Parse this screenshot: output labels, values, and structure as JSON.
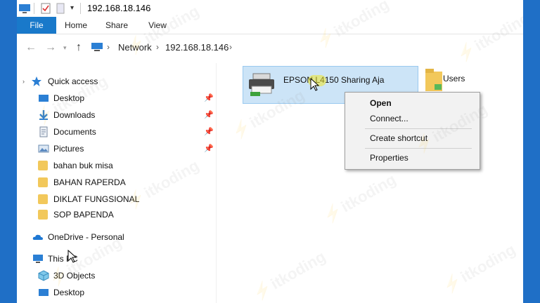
{
  "window": {
    "title": "192.168.18.146"
  },
  "ribbon": {
    "tabs": [
      "File",
      "Home",
      "Share",
      "View"
    ]
  },
  "address": {
    "crumbs": [
      "Network",
      "192.168.18.146"
    ]
  },
  "sidebar": {
    "quick_access": "Quick access",
    "items": [
      "Desktop",
      "Downloads",
      "Documents",
      "Pictures",
      "bahan buk misa",
      "BAHAN RAPERDA",
      "DIKLAT FUNGSIONAL",
      "SOP BAPENDA"
    ],
    "onedrive": "OneDrive - Personal",
    "this_pc": "This PC",
    "pc_items": [
      "3D Objects",
      "Desktop"
    ]
  },
  "content": {
    "printer": "EPSON L4150 Sharing Aja",
    "users": "Users"
  },
  "context_menu": {
    "items": [
      "Open",
      "Connect...",
      "Create shortcut",
      "Properties"
    ]
  },
  "watermark": {
    "text": "itkoding"
  },
  "colors": {
    "accent": "#1979ca",
    "selection": "#cce4f7",
    "frame": "#1f6fc6"
  }
}
